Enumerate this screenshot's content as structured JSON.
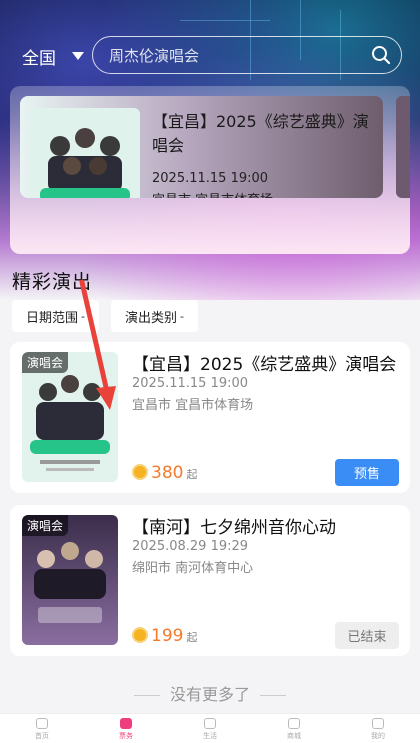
{
  "header": {
    "region": "全国",
    "search_placeholder": "周杰伦演唱会"
  },
  "featured": {
    "title": "【宜昌】2025《综艺盛典》演唱会",
    "date": "2025.11.15 19:00",
    "venue": "宜昌市 宜昌市体育场"
  },
  "section": {
    "title": "精彩演出",
    "filters": [
      "日期范围",
      "演出类别"
    ]
  },
  "events": [
    {
      "tag": "演唱会",
      "title": "【宜昌】2025《综艺盛典》演唱会",
      "date": "2025.11.15 19:00",
      "venue": "宜昌市 宜昌市体育场",
      "price": "380",
      "price_unit": "起",
      "action": "预售"
    },
    {
      "tag": "演唱会",
      "title": "【南河】七夕绵州音你心动",
      "date": "2025.08.29 19:29",
      "venue": "绵阳市 南河体育中心",
      "price": "199",
      "price_unit": "起",
      "action": "已结束"
    }
  ],
  "footer": {
    "no_more": "没有更多了"
  },
  "tabbar": {
    "items": [
      "首页",
      "票务",
      "生活",
      "商城",
      "我的"
    ],
    "active_index": 1,
    "active_color": "#ef3e7e"
  },
  "colors": {
    "presale_button": "#3a8df5",
    "price": "#f57a2a"
  }
}
